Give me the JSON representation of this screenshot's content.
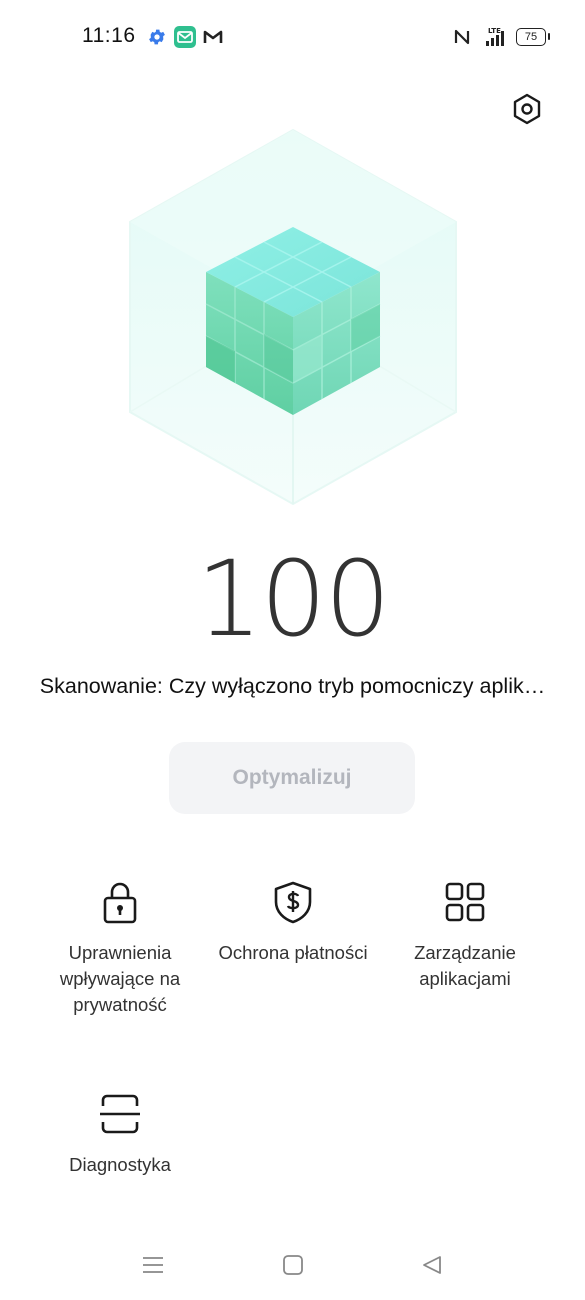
{
  "status_bar": {
    "time": "11:16",
    "notification_icons": [
      "settings-gear-icon",
      "message-icon",
      "gmail-icon"
    ],
    "system_icons": [
      "nfc-icon",
      "lte-signal-icon"
    ],
    "network_label": "LTE",
    "battery_level": "75"
  },
  "header": {
    "settings_icon": "settings-icon"
  },
  "hero": {
    "illustration": "security-cube-illustration",
    "accent_colors": [
      "#7fe6dc",
      "#63cfa3",
      "#e9fbf8"
    ]
  },
  "score": {
    "value": "100"
  },
  "scan": {
    "text": "Skanowanie: Czy wyłączono tryb pomocniczy aplik…"
  },
  "optimize_button": {
    "label": "Optymalizuj"
  },
  "features": [
    {
      "icon": "lock-icon",
      "label": "Uprawnienia wpływające na prywatność"
    },
    {
      "icon": "shield-dollar-icon",
      "label": "Ochrona płatności"
    },
    {
      "icon": "grid-apps-icon",
      "label": "Zarządzanie aplikacjami"
    },
    {
      "icon": "scan-frame-icon",
      "label": "Diagnostyka"
    }
  ],
  "nav_bar": {
    "menu_icon": "menu-icon",
    "home_icon": "home-square-icon",
    "back_icon": "back-triangle-icon"
  }
}
